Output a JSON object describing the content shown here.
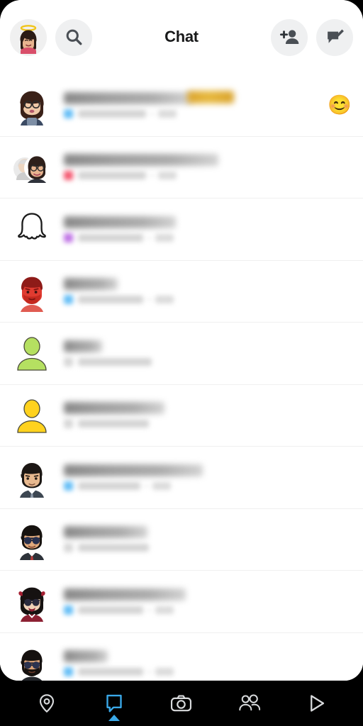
{
  "app": {
    "name": "Snapchat"
  },
  "status": {
    "notification_dot_color": "#e8c94a"
  },
  "header": {
    "title": "Chat",
    "profile_avatar_name": "profile-bitmoji-halo",
    "search_label": "Search",
    "add_friend_label": "Add Friend",
    "new_chat_label": "New Chat"
  },
  "colors": {
    "accent_blue": "#3aa8e8",
    "status_chat_received": "#4ab3f4",
    "status_snap_received": "#f23b57",
    "status_team": "#b45ce0",
    "nav_background": "#000000",
    "sheet_background": "#ffffff",
    "divider": "#f0f0f0"
  },
  "chats": [
    {
      "avatar": "bitmoji-female-glasses",
      "avatar_type": "bitmoji",
      "name_redacted": true,
      "name_width": 180,
      "has_gold_emoji_in_name": true,
      "status_color": "#4ab3f4",
      "status_width": 96,
      "has_time": true,
      "reaction": "😊"
    },
    {
      "avatar": "bitmoji-group-two-people",
      "avatar_type": "group",
      "name_redacted": true,
      "name_width": 218,
      "has_gold_emoji_in_name": false,
      "status_color": "#f23b57",
      "status_width": 96,
      "has_time": true,
      "reaction": ""
    },
    {
      "avatar": "snapchat-ghost-logo",
      "avatar_type": "ghost",
      "name_redacted": true,
      "name_width": 158,
      "has_gold_emoji_in_name": false,
      "status_color": "#b45ce0",
      "status_width": 92,
      "has_time": true,
      "reaction": ""
    },
    {
      "avatar": "bitmoji-red-beard-man",
      "avatar_type": "bitmoji",
      "name_redacted": true,
      "name_width": 76,
      "has_gold_emoji_in_name": false,
      "status_color": "#4ab3f4",
      "status_width": 92,
      "has_time": true,
      "reaction": ""
    },
    {
      "avatar": "default-avatar-green",
      "avatar_type": "silhouette-green",
      "name_redacted": true,
      "name_width": 54,
      "has_gold_emoji_in_name": false,
      "status_color": "#d0d0d0",
      "status_width": 104,
      "has_time": false,
      "reaction": ""
    },
    {
      "avatar": "default-avatar-yellow",
      "avatar_type": "silhouette-yellow",
      "name_redacted": true,
      "name_width": 142,
      "has_gold_emoji_in_name": false,
      "status_color": "#d0d0d0",
      "status_width": 100,
      "has_time": false,
      "reaction": ""
    },
    {
      "avatar": "bitmoji-man-suit",
      "avatar_type": "bitmoji",
      "name_redacted": true,
      "name_width": 196,
      "has_gold_emoji_in_name": false,
      "status_color": "#4ab3f4",
      "status_width": 88,
      "has_time": true,
      "reaction": ""
    },
    {
      "avatar": "bitmoji-man-sunglasses-suit",
      "avatar_type": "bitmoji",
      "name_redacted": true,
      "name_width": 118,
      "has_gold_emoji_in_name": false,
      "status_color": "#d0d0d0",
      "status_width": 100,
      "has_time": false,
      "reaction": ""
    },
    {
      "avatar": "bitmoji-female-sunglasses-bow",
      "avatar_type": "bitmoji",
      "name_redacted": true,
      "name_width": 172,
      "has_gold_emoji_in_name": false,
      "status_color": "#4ab3f4",
      "status_width": 92,
      "has_time": true,
      "reaction": ""
    },
    {
      "avatar": "bitmoji-bearded-man-sunglasses",
      "avatar_type": "bitmoji",
      "name_redacted": true,
      "name_width": 62,
      "has_gold_emoji_in_name": false,
      "status_color": "#4ab3f4",
      "status_width": 92,
      "has_time": true,
      "reaction": ""
    }
  ],
  "bottom_nav": {
    "active_index": 1,
    "items": [
      {
        "icon": "map-pin-icon",
        "label": "Map"
      },
      {
        "icon": "chat-bubble-icon",
        "label": "Chat"
      },
      {
        "icon": "camera-icon",
        "label": "Camera"
      },
      {
        "icon": "friends-icon",
        "label": "Stories"
      },
      {
        "icon": "play-icon",
        "label": "Spotlight"
      }
    ]
  }
}
